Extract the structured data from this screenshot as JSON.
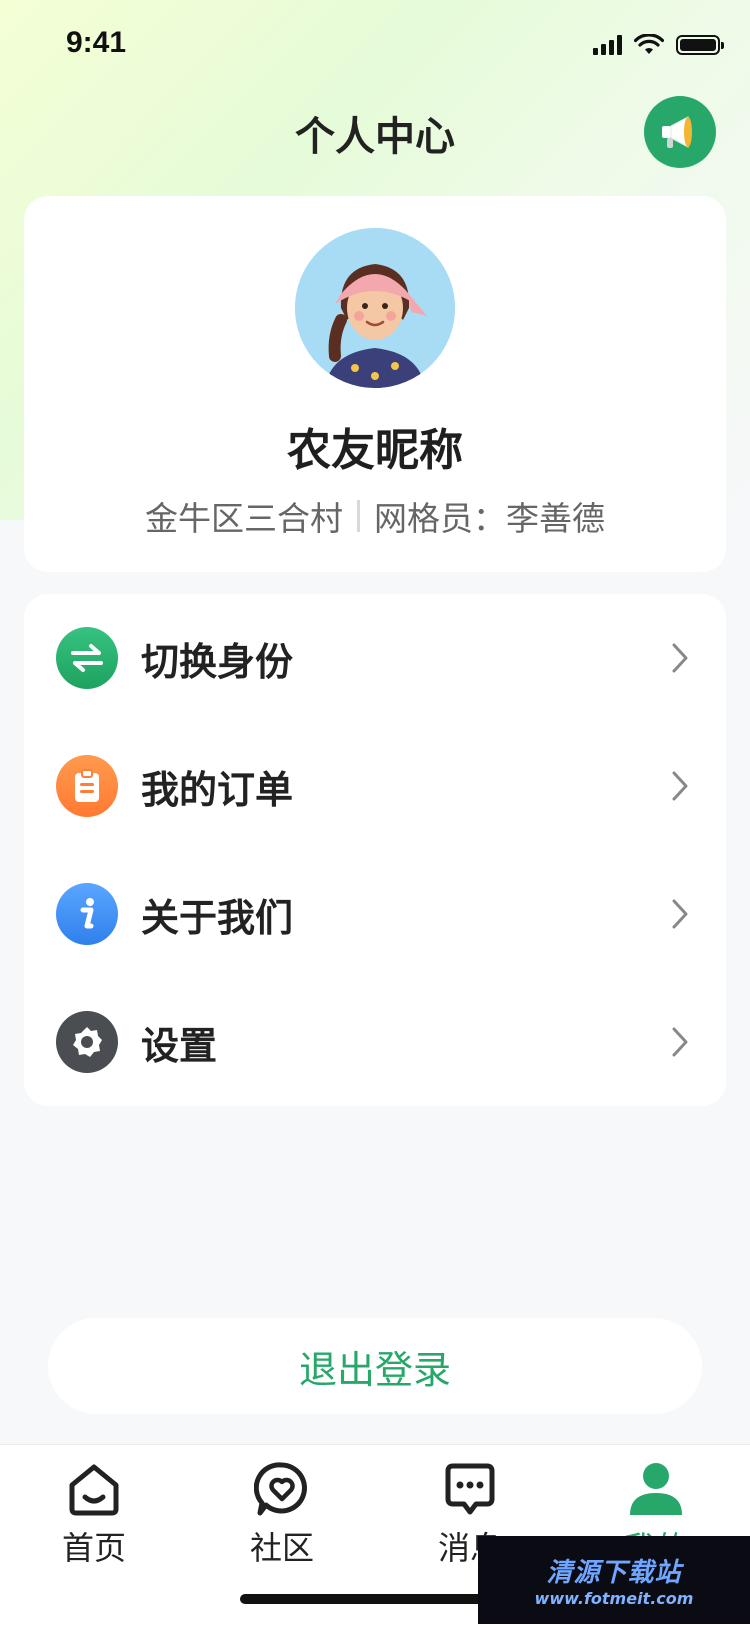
{
  "status_bar": {
    "time": "9:41"
  },
  "header": {
    "title": "个人中心",
    "megaphone_icon": "megaphone-icon"
  },
  "profile": {
    "nickname": "农友昵称",
    "location": "金牛区三合村",
    "grid_officer": "网格员：李善德"
  },
  "menu": {
    "items": [
      {
        "label": "切换身份",
        "icon": "switch-identity-icon",
        "color": "#27b16e"
      },
      {
        "label": "我的订单",
        "icon": "clipboard-icon",
        "color": "#ff7f3a"
      },
      {
        "label": "关于我们",
        "icon": "info-icon",
        "color": "#3a8ef5"
      },
      {
        "label": "设置",
        "icon": "gear-icon",
        "color": "#4a4d52"
      }
    ]
  },
  "logout_label": "退出登录",
  "tabbar": {
    "tabs": [
      {
        "label": "首页",
        "icon": "home-icon"
      },
      {
        "label": "社区",
        "icon": "heart-bubble-icon"
      },
      {
        "label": "消息",
        "icon": "chat-icon"
      },
      {
        "label": "我的",
        "icon": "person-icon",
        "active": true
      }
    ]
  },
  "watermark": {
    "text": "清源下载站",
    "url": "www.fotmeit.com"
  },
  "colors": {
    "accent": "#27a86a",
    "text_primary": "#222222",
    "text_secondary": "#666666"
  }
}
